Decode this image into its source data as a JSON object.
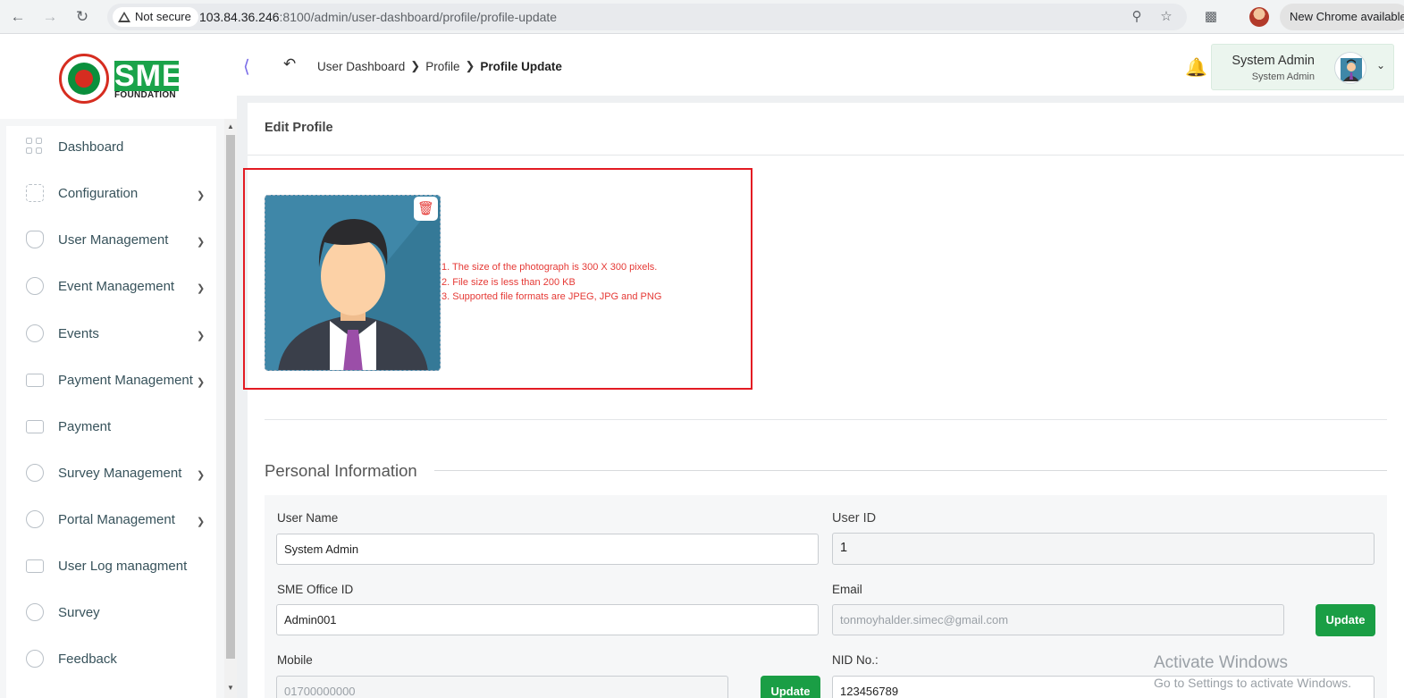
{
  "browser": {
    "security_label": "Not secure",
    "url_host": "103.84.36.246",
    "url_rest": ":8100/admin/user-dashboard/profile/profile-update",
    "update_chip": "New Chrome available"
  },
  "header": {
    "logo_text": "SME",
    "logo_sub": "FOUNDATION",
    "breadcrumb": [
      "User Dashboard",
      "Profile",
      "Profile Update"
    ],
    "user_name": "System Admin",
    "user_role": "System Admin"
  },
  "sidebar": {
    "items": [
      {
        "label": "Dashboard",
        "icon": "grid-icon",
        "has_submenu": false
      },
      {
        "label": "Configuration",
        "icon": "configuration-icon",
        "has_submenu": true
      },
      {
        "label": "User Management",
        "icon": "shield-icon",
        "has_submenu": true
      },
      {
        "label": "Event Management",
        "icon": "lock-circle-icon",
        "has_submenu": true
      },
      {
        "label": "Events",
        "icon": "lock-circle-icon",
        "has_submenu": true
      },
      {
        "label": "Payment Management",
        "icon": "money-icon",
        "has_submenu": true
      },
      {
        "label": "Payment",
        "icon": "money-icon",
        "has_submenu": false
      },
      {
        "label": "Survey Management",
        "icon": "pie-icon",
        "has_submenu": true
      },
      {
        "label": "Portal Management",
        "icon": "lock-circle-icon",
        "has_submenu": true
      },
      {
        "label": "User Log managment",
        "icon": "money-icon",
        "has_submenu": false
      },
      {
        "label": "Survey",
        "icon": "pie-icon",
        "has_submenu": false
      },
      {
        "label": "Feedback",
        "icon": "feedback-icon",
        "has_submenu": false
      }
    ]
  },
  "main": {
    "card_title": "Edit Profile",
    "photo_rules": [
      "1. The size of the photograph is 300 X 300 pixels.",
      "2. File size is less than 200 KB",
      "3. Supported file formats are JPEG, JPG and PNG"
    ],
    "section_title": "Personal Information",
    "fields": {
      "user_name": {
        "label": "User Name",
        "value": "System Admin"
      },
      "user_id": {
        "label": "User ID",
        "value": "1"
      },
      "office_id": {
        "label": "SME Office ID",
        "value": "Admin001"
      },
      "email": {
        "label": "Email",
        "value": "tonmoyhalder.simec@gmail.com"
      },
      "mobile": {
        "label": "Mobile",
        "value": "01700000000"
      },
      "nid": {
        "label": "NID No.:",
        "value": "123456789"
      }
    },
    "update_label": "Update"
  },
  "watermark": {
    "line1": "Activate Windows",
    "line2": "Go to Settings to activate Windows."
  },
  "colors": {
    "brand_green": "#1a9e45",
    "highlight_red": "#e31b23",
    "rule_text": "#e53935"
  }
}
